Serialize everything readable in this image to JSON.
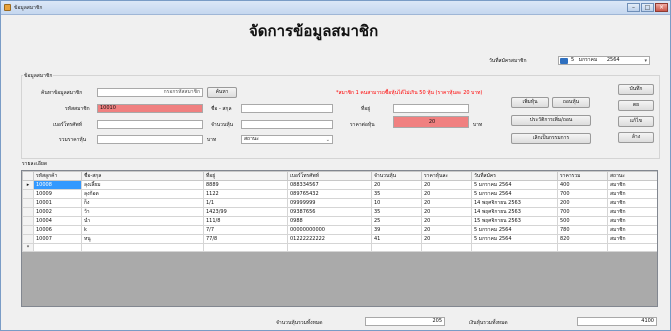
{
  "window": {
    "title": "ข้อมูลสมาชิก"
  },
  "page_title": "จัดการข้อมูลสมาชิก",
  "date_label": "วันที่สมัครสมาชิก",
  "date_picker": {
    "day": "5",
    "month": "มกราคม",
    "year": "2564"
  },
  "member_group": {
    "label": "ข้อมูลสมาชิก"
  },
  "search": {
    "label": "ค้นหาข้อมูลสมาชิก",
    "placeholder": "กรอกรหัสสมาชิก",
    "button": "ค้นหา"
  },
  "form": {
    "member_id_label": "รหัสสมาชิก",
    "member_id_value": "10010",
    "name_label": "ชื่อ - สกุล",
    "name_value": "",
    "address_label": "ที่อยู่",
    "address_value": "",
    "phone_label": "เบอร์โทรศัพท์",
    "phone_value": "",
    "shares_label": "จำนวนหุ้น",
    "shares_value": "",
    "price_label": "ราคาต่อหุ้น",
    "price_value": "20",
    "price_unit": "บาท",
    "total_label": "รวมราคาหุ้น",
    "total_value": "",
    "total_unit": "บาท",
    "status_value": "สถานะ",
    "note": "*สมาชิก 1 คนสามารถซื้อหุ้นได้ไม่เกิน 50 หุ้น (ราคาหุ้นละ 20 บาท)"
  },
  "buttons": {
    "save": "บันทึก",
    "clear": "ตย",
    "edit": "แก้ไข",
    "delete": "ล้าง",
    "add_shares": "เพิ่มหุ้น",
    "withdraw_shares": "ถอนหุ้น",
    "history": "ประวัติการเพิ่ม/ถอน",
    "cancel_membership": "เลิกเป็นกรรมการ"
  },
  "details_group": {
    "label": "รายละเอียด"
  },
  "table": {
    "columns": [
      "รหัสลูกค้า",
      "ชื่อ-สกุล",
      "ที่อยู่",
      "เบอร์โทรศัพท์",
      "จำนวนหุ้น",
      "ราคาหุ้นละ",
      "วันที่สมัคร",
      "ราคารวม",
      "สถานะ"
    ],
    "rows": [
      [
        "10008",
        "ลุงเลี้ยม",
        "8889",
        "088334567",
        "20",
        "20",
        "5 มกราคม 2564",
        "400",
        "สมาชิก"
      ],
      [
        "10009",
        "ลุงก้อด",
        "1122",
        "089765432",
        "35",
        "20",
        "5 มกราคม 2564",
        "700",
        "สมาชิก"
      ],
      [
        "10001",
        "ก็ง",
        "1/1",
        "09999999",
        "10",
        "20",
        "14 พฤศจิกายน 2563",
        "200",
        "สมาชิก"
      ],
      [
        "10002",
        "ว้า",
        "1423/99",
        "09387656",
        "35",
        "20",
        "14 พฤศจิกายน 2563",
        "700",
        "สมาชิก"
      ],
      [
        "10004",
        "น่ำ",
        "111/8",
        "0988",
        "25",
        "20",
        "15 พฤศจิกายน 2563",
        "500",
        "สมาชิก"
      ],
      [
        "10006",
        "k",
        "7/7",
        "00000000000",
        "39",
        "20",
        "5 มกราคม 2564",
        "780",
        "สมาชิก"
      ],
      [
        "10007",
        "หนู",
        "77/8",
        "01222222222",
        "41",
        "20",
        "5 มกราคม 2564",
        "820",
        "สมาชิก"
      ]
    ],
    "new_row_marker": "*",
    "selected_marker": "▸"
  },
  "footer": {
    "total_shares_label": "จำนวนหุ้นรวมทั้งหมด",
    "total_shares_value": "205",
    "total_money_label": "เงินหุ้นรวมทั้งหมด",
    "total_money_value": "4100"
  },
  "colors": {
    "highlight": "#f08080",
    "selection": "#3399ff",
    "note": "#ff0000"
  }
}
